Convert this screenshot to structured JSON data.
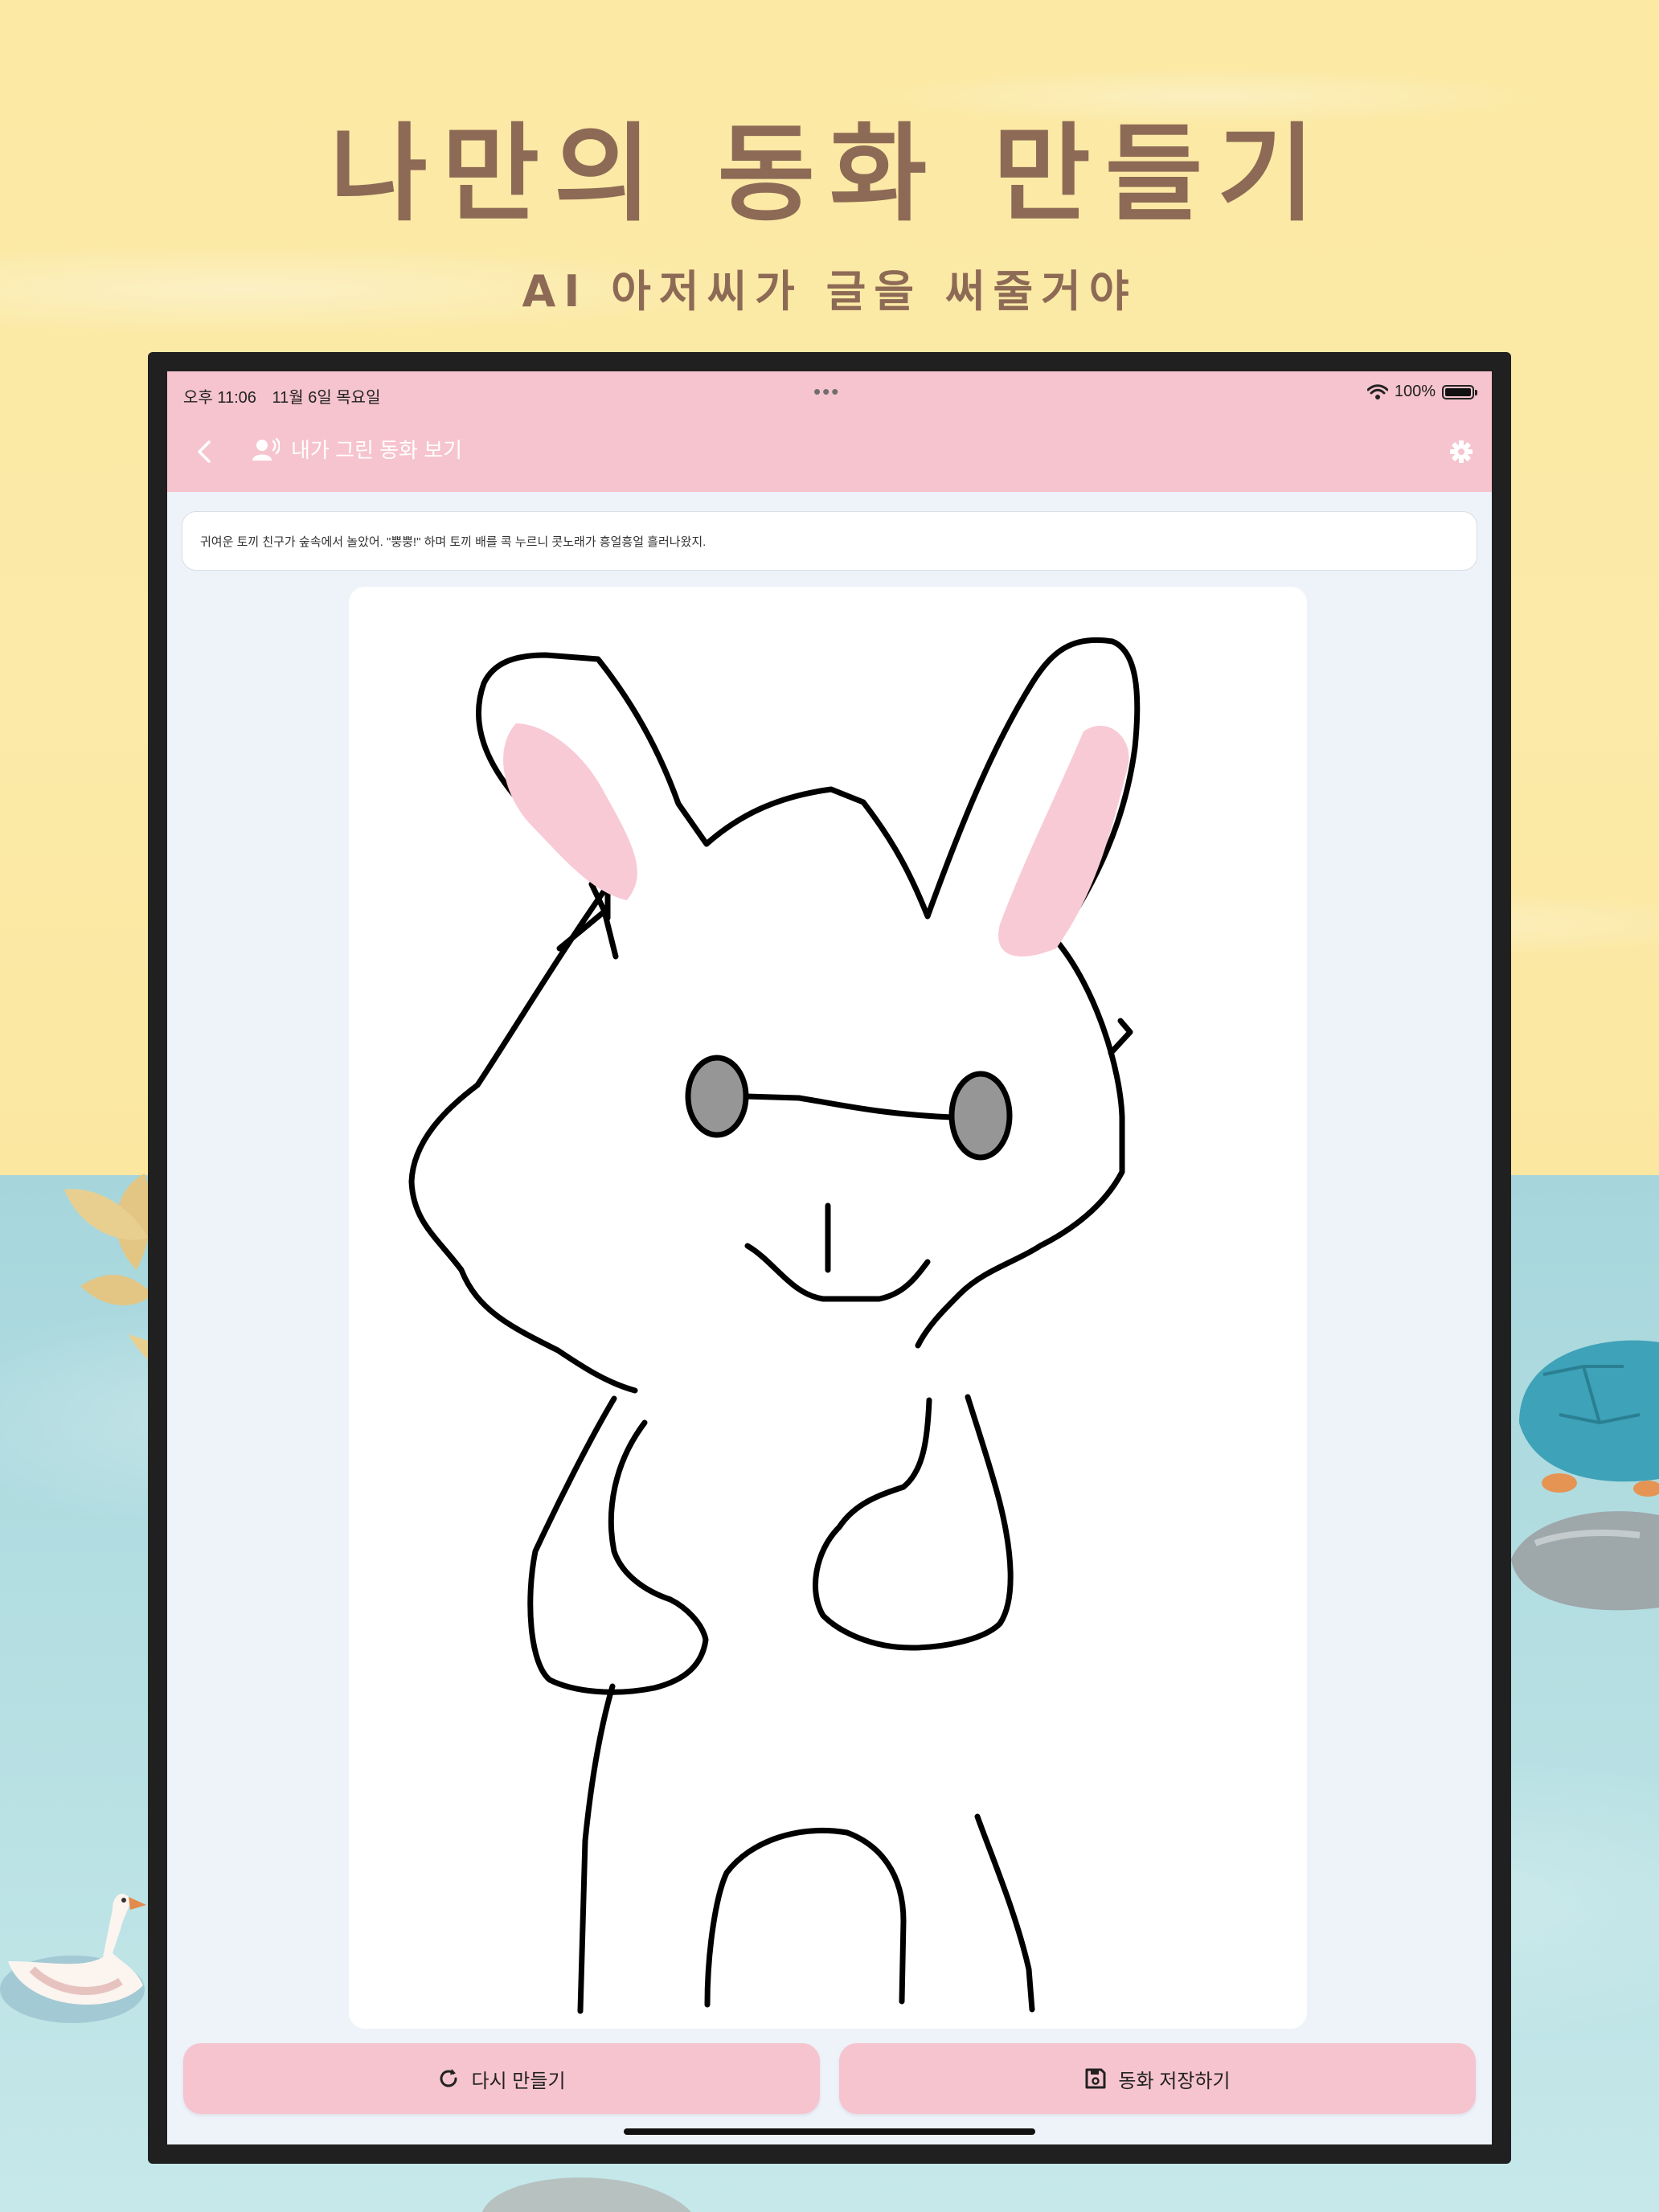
{
  "promo": {
    "title": "나만의 동화 만들기",
    "subtitle": "AI 아저씨가 글을 써줄거야"
  },
  "status_bar": {
    "time": "오후 11:06",
    "date": "11월 6일 목요일",
    "battery": "100%"
  },
  "nav": {
    "back_icon": "chevron-left-icon",
    "title_icon": "voice-person-icon",
    "title": "내가 그린 동화 보기",
    "settings_icon": "gear-icon"
  },
  "story": {
    "text": "귀여운 토끼 친구가 숲속에서 놀았어. \"뿡뿡!\" 하며 토끼 배를 콕 누르니 콧노래가 흥얼흥얼 흘러나왔지."
  },
  "drawing": {
    "subject": "rabbit drawing"
  },
  "actions": {
    "regenerate_label": "다시 만들기",
    "regenerate_icon": "refresh-icon",
    "save_label": "동화 저장하기",
    "save_icon": "floppy-disk-icon"
  },
  "colors": {
    "accent_pink": "#f6c4cf",
    "title_brown": "#8d6a55",
    "background_yellow": "#fbe9a4",
    "background_blue": "#a6d6dc"
  }
}
